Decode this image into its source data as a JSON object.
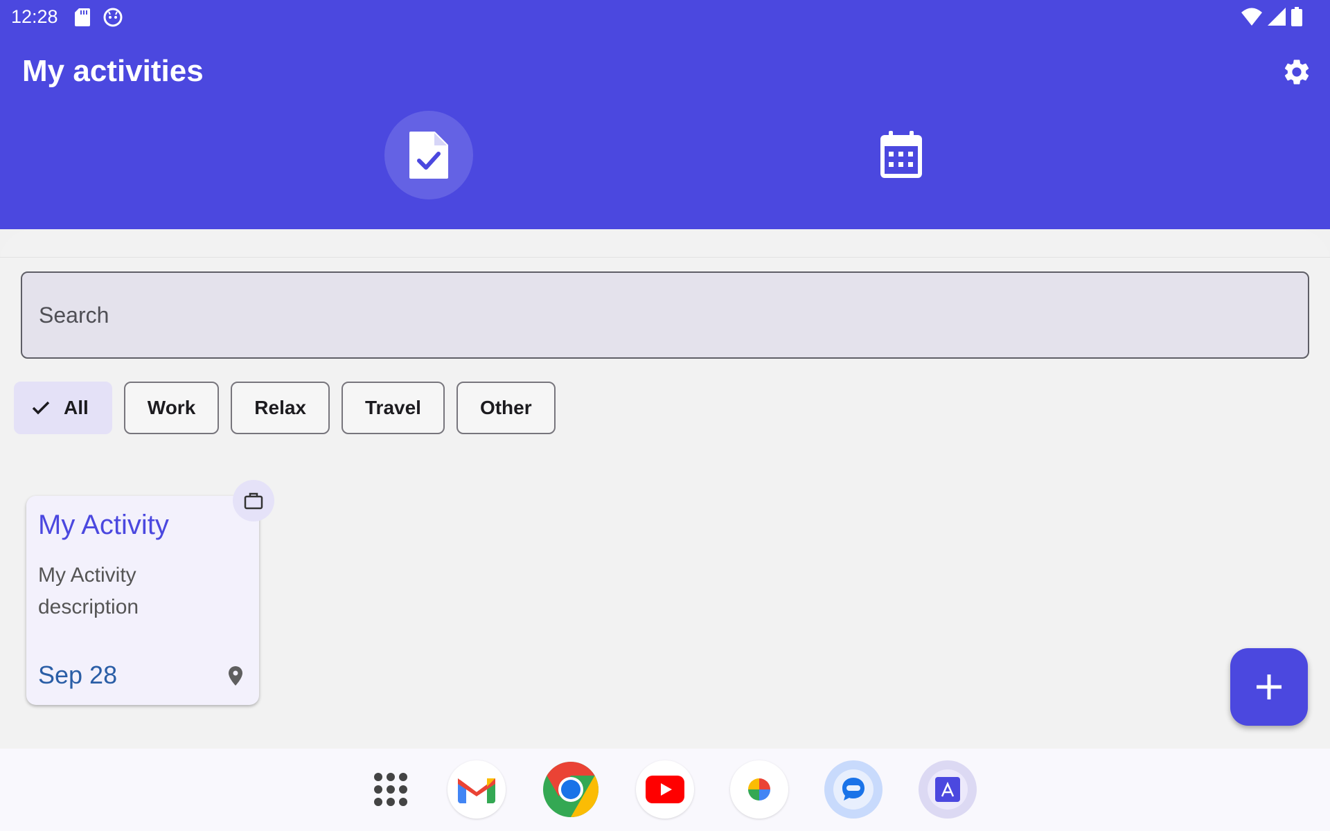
{
  "status_bar": {
    "time": "12:28",
    "icons": [
      "sd-card-icon",
      "cat-face-icon",
      "wifi-icon",
      "signal-icon",
      "battery-icon"
    ]
  },
  "app": {
    "title": "My activities",
    "settings_icon": "gear-icon",
    "accent_color": "#4b48df"
  },
  "tabs": [
    {
      "name": "list",
      "icon": "document-check-icon",
      "active": true
    },
    {
      "name": "calendar",
      "icon": "calendar-icon",
      "active": false
    }
  ],
  "search": {
    "placeholder": "Search",
    "value": ""
  },
  "filters": [
    {
      "label": "All",
      "selected": true
    },
    {
      "label": "Work",
      "selected": false
    },
    {
      "label": "Relax",
      "selected": false
    },
    {
      "label": "Travel",
      "selected": false
    },
    {
      "label": "Other",
      "selected": false
    }
  ],
  "activities": [
    {
      "title": "My Activity",
      "description": "My Activity description",
      "date": "Sep 28",
      "category_icon": "briefcase-icon",
      "location_icon": "location-pin-icon"
    }
  ],
  "fab": {
    "icon": "plus-icon"
  },
  "dock": [
    "app-drawer-icon",
    "gmail-icon",
    "chrome-icon",
    "youtube-icon",
    "photos-icon",
    "messages-icon",
    "app-store-icon"
  ]
}
